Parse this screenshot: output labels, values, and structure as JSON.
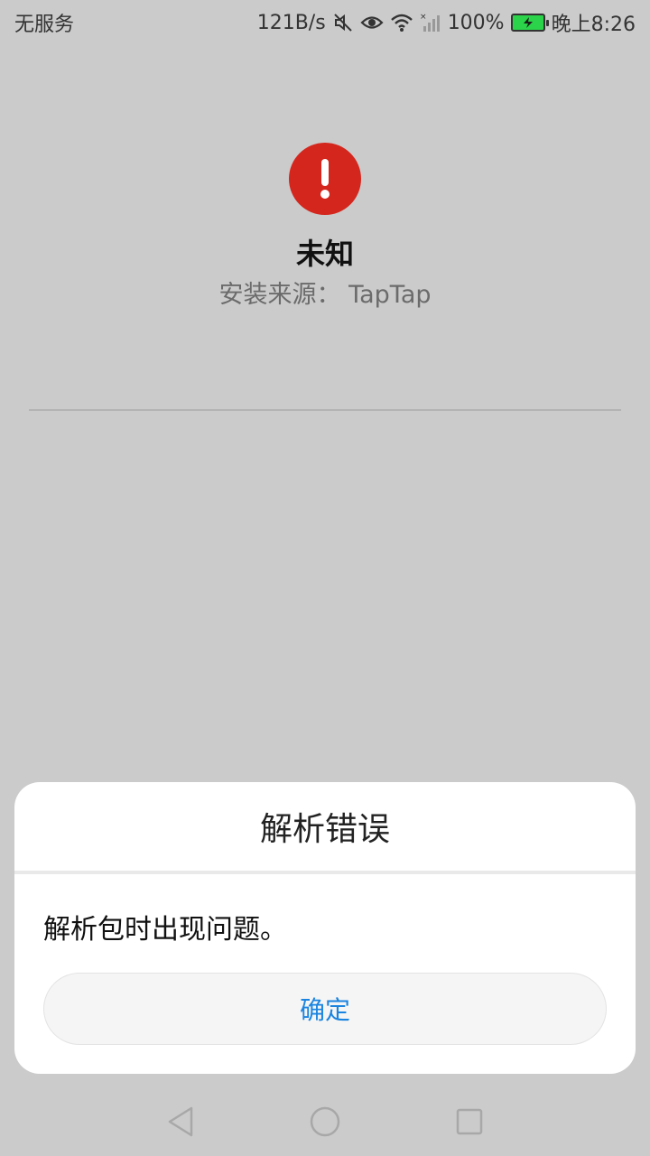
{
  "status_bar": {
    "carrier": "无服务",
    "net_speed": "121B/s",
    "battery_percent": "100%",
    "time": "晚上8:26",
    "icons": [
      "mute-icon",
      "eye-icon",
      "wifi-icon",
      "signal-icon",
      "battery-charging-icon"
    ],
    "battery_color": "#2bd34a"
  },
  "app": {
    "icon": "error-icon",
    "icon_color": "#d4261d",
    "name": "未知",
    "install_source": "安装来源： TapTap"
  },
  "dialog": {
    "title": "解析错误",
    "message": "解析包时出现问题。",
    "confirm_label": "确定",
    "accent_color": "#1a84e0"
  },
  "nav_bar": {
    "icons": [
      "back-icon",
      "home-icon",
      "recents-icon"
    ]
  }
}
